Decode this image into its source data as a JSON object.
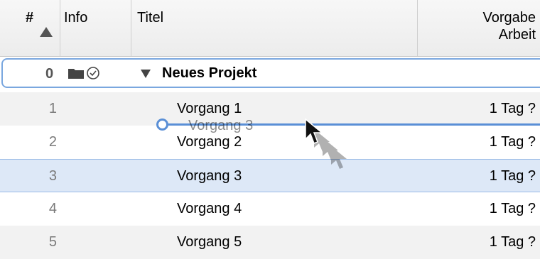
{
  "columns": {
    "number": "#",
    "info": "Info",
    "title": "Titel",
    "work_line1": "Vorgabe",
    "work_line2": "Arbeit"
  },
  "project": {
    "number": "0",
    "title": "Neues Projekt"
  },
  "rows": [
    {
      "number": "1",
      "title": "Vorgang 1",
      "work": "1 Tag ?"
    },
    {
      "number": "2",
      "title": "Vorgang 2",
      "work": "1 Tag ?"
    },
    {
      "number": "3",
      "title": "Vorgang 3",
      "work": "1 Tag ?"
    },
    {
      "number": "4",
      "title": "Vorgang 4",
      "work": "1 Tag ?"
    },
    {
      "number": "5",
      "title": "Vorgang 5",
      "work": "1 Tag ?"
    }
  ],
  "drag": {
    "ghost_label": "Vorgang 3"
  },
  "icons": {
    "sort": "sort-ascending-icon",
    "folder": "folder-icon",
    "clock": "clock-icon",
    "disclosure": "disclosure-triangle-icon",
    "cursor": "arrow-cursor-icon"
  },
  "colors": {
    "selection": "#dde8f7",
    "accent": "#5a8fd6",
    "alt_row": "#f2f2f2"
  }
}
